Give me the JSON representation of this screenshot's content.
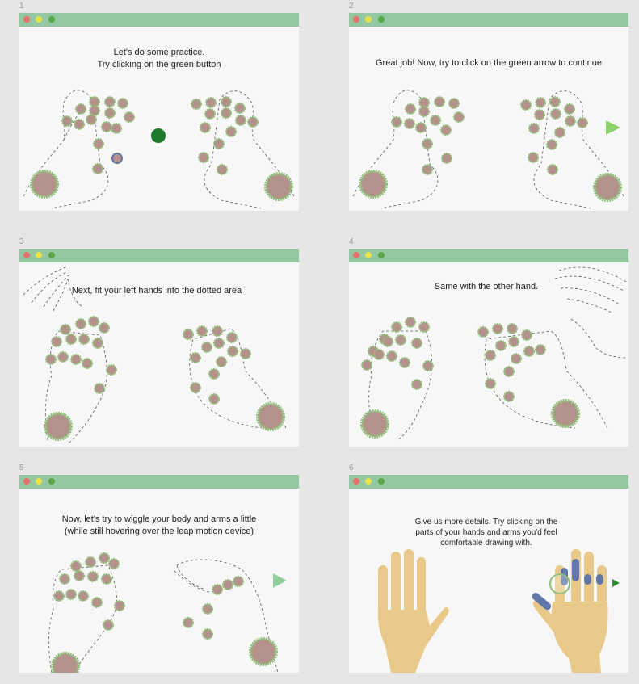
{
  "panels": [
    {
      "number": "1",
      "message_lines": [
        "Let's do some practice.",
        "Try clicking on the green button"
      ]
    },
    {
      "number": "2",
      "message_lines": [
        "Great job! Now, try to click on the green arrow to continue"
      ]
    },
    {
      "number": "3",
      "message_lines": [
        "Next, fit your left hands into the dotted area"
      ]
    },
    {
      "number": "4",
      "message_lines": [
        "Same with the other hand."
      ]
    },
    {
      "number": "5",
      "message_lines": [
        "Now, let's try to wiggle your body and arms a little",
        "(while still hovering over the leap motion device)"
      ]
    },
    {
      "number": "6",
      "message_lines": [
        "Give us more details. Try clicking on the",
        "parts of your hands and arms you'd feel",
        "comfortable drawing with."
      ]
    }
  ],
  "colors": {
    "titlebar": "#92c7a1",
    "marker_fill": "#b5918b",
    "marker_ring": "#8fbf7a",
    "green_button": "#1f7a2a",
    "arrow": "#8fd06a",
    "skin": "#e8c98a",
    "selection_blue": "#6277a8"
  },
  "icons": {
    "close": "red-dot-icon",
    "minimize": "yellow-dot-icon",
    "maximize": "green-dot-icon",
    "next_arrow": "triangle-right-icon"
  }
}
